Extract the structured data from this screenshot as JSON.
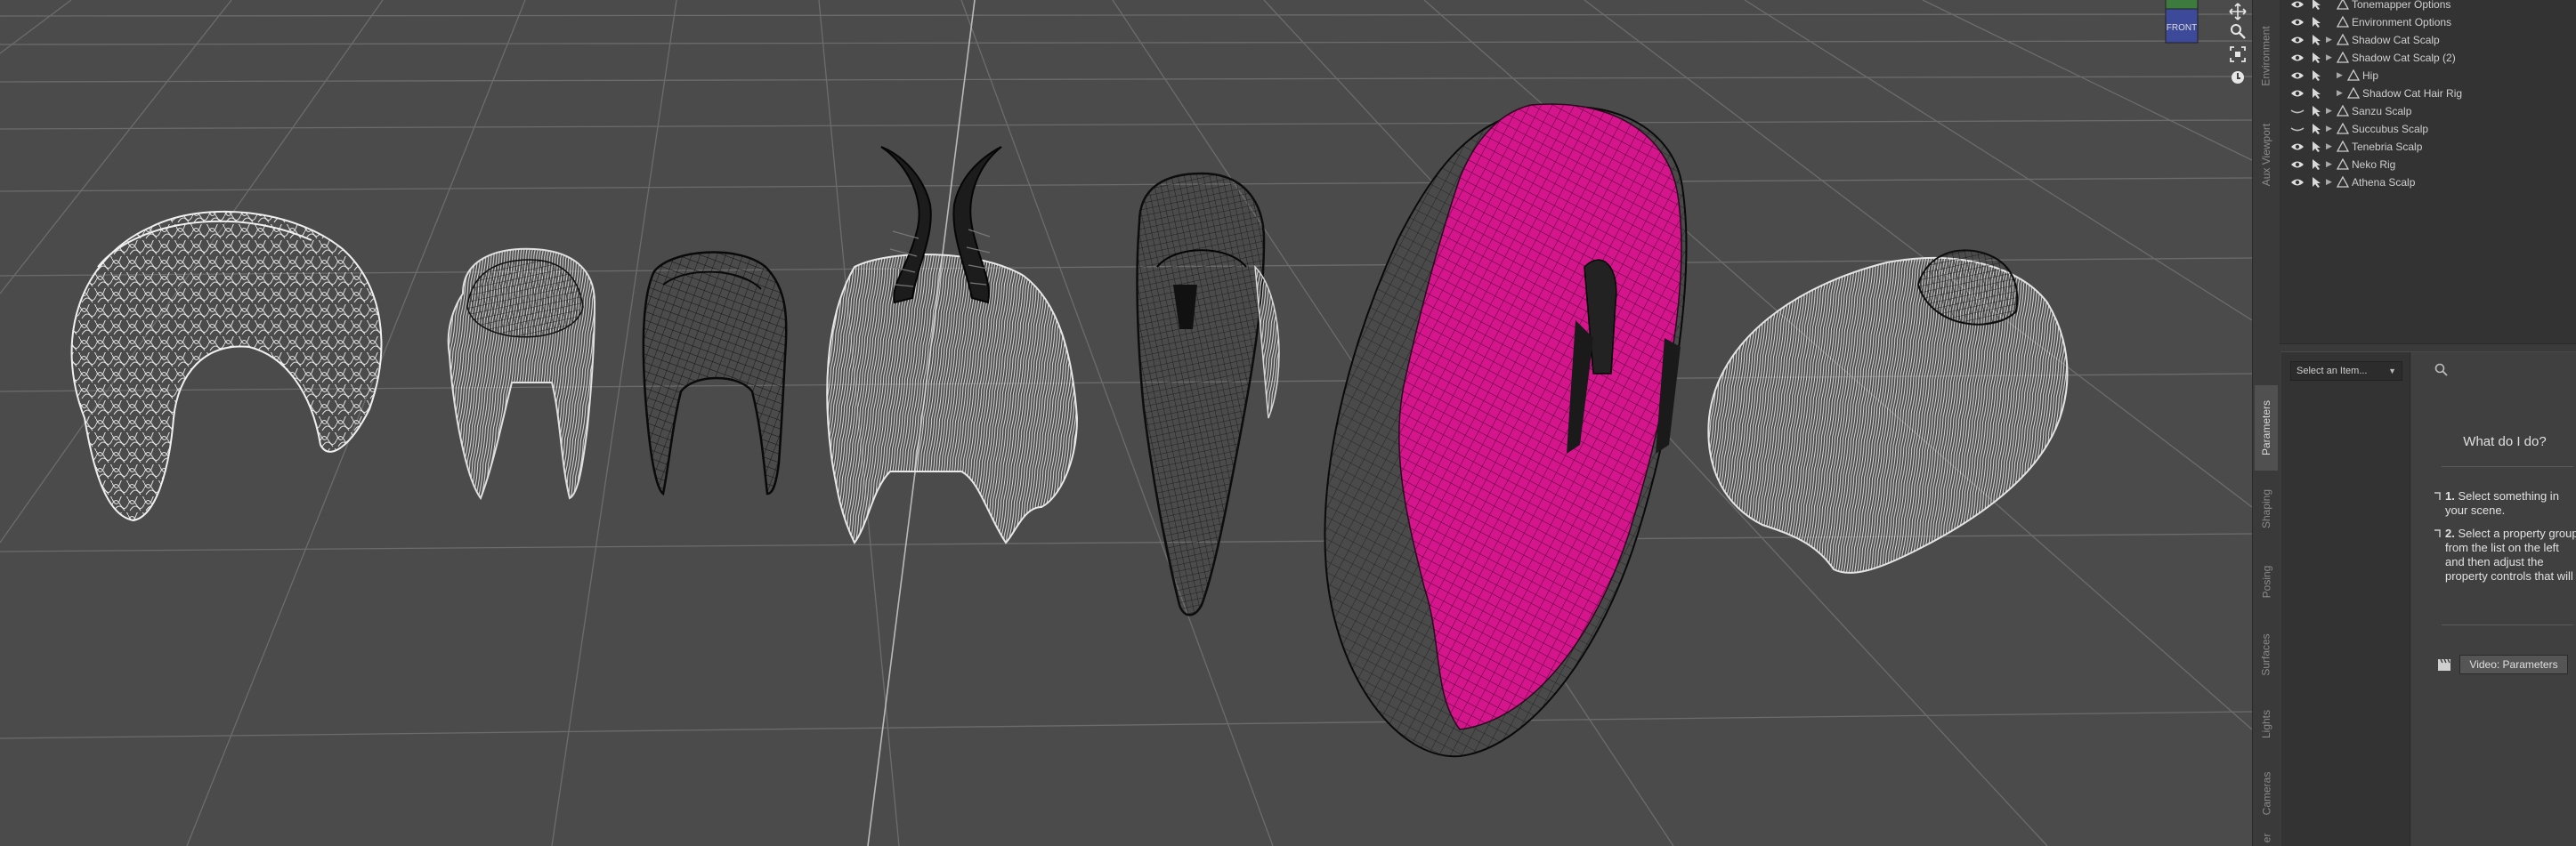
{
  "scene_tree": {
    "rows": [
      {
        "label": "Tonemapper Options",
        "depth": 0,
        "expandable": false,
        "visible": true
      },
      {
        "label": "Environment Options",
        "depth": 0,
        "expandable": false,
        "visible": true
      },
      {
        "label": "Shadow Cat Scalp",
        "depth": 0,
        "expandable": true,
        "visible": true
      },
      {
        "label": "Shadow Cat Scalp (2)",
        "depth": 0,
        "expandable": true,
        "visible": true
      },
      {
        "label": "Hip",
        "depth": 1,
        "expandable": true,
        "visible": true
      },
      {
        "label": "Shadow Cat Hair Rig",
        "depth": 1,
        "expandable": true,
        "visible": true
      },
      {
        "label": "Sanzu Scalp",
        "depth": 0,
        "expandable": true,
        "visible": false
      },
      {
        "label": "Succubus Scalp",
        "depth": 0,
        "expandable": true,
        "visible": false
      },
      {
        "label": "Tenebria Scalp",
        "depth": 0,
        "expandable": true,
        "visible": true
      },
      {
        "label": "Neko Rig",
        "depth": 0,
        "expandable": true,
        "visible": true
      },
      {
        "label": "Athena Scalp",
        "depth": 0,
        "expandable": true,
        "visible": true
      }
    ]
  },
  "side_tabs_top": [
    "Environment",
    "Aux Viewport"
  ],
  "side_tabs_bottom": [
    {
      "label": "Parameters",
      "active": true
    },
    {
      "label": "Shaping",
      "active": false
    },
    {
      "label": "Posing",
      "active": false
    },
    {
      "label": "Surfaces",
      "active": false
    },
    {
      "label": "Lights",
      "active": false
    },
    {
      "label": "Cameras",
      "active": false
    },
    {
      "label": "er",
      "active": false
    }
  ],
  "parameters": {
    "select_item": "Select an Item...",
    "help_title": "What do I do?",
    "steps": [
      {
        "num": "1.",
        "text": "Select something in your scene."
      },
      {
        "num": "2.",
        "text": "Select a property group from the list on the left and then adjust the property controls that will"
      }
    ],
    "video_button": "Video: Parameters"
  },
  "viewport": {
    "cube_label": "FRONT"
  },
  "colors": {
    "viewport_bg": "#4b4b4b",
    "grid": "#6e6e6e",
    "hair": "#d6d6d6",
    "wire": "#111111",
    "selection_magenta": "#d4158c",
    "panel_bg": "#333333"
  }
}
